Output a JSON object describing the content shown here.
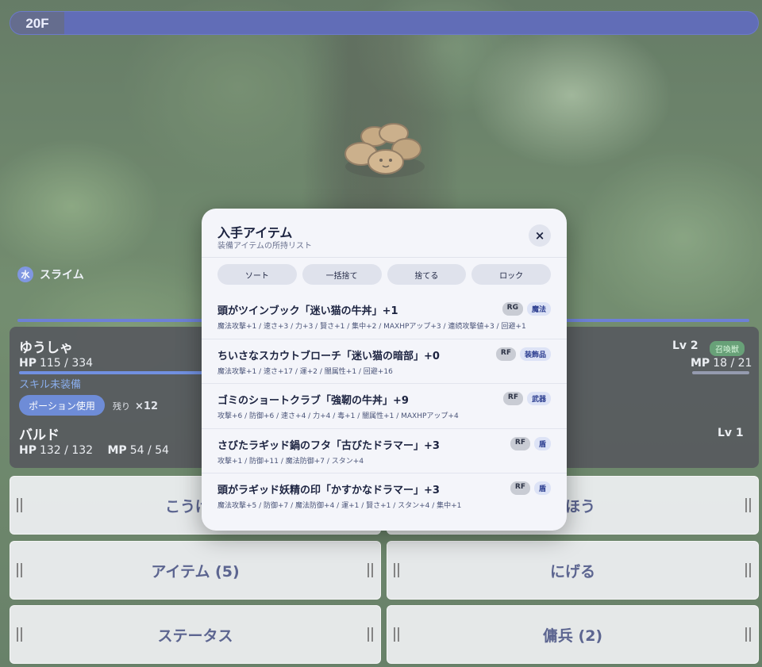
{
  "floor": {
    "label": "20F"
  },
  "enemy": {
    "element": "水",
    "name": "スライム"
  },
  "party": {
    "hero": {
      "name": "ゆうしゃ",
      "hp_label": "HP",
      "hp": "115 / 334",
      "lv": "Lv 2",
      "summon_badge": "召喚獣",
      "mp_label": "MP",
      "mp": "18 / 21",
      "skill": "スキル未装備",
      "potion_button": "ポーション使用",
      "potion_rest_label": "残り",
      "potion_rest_count": "×12"
    },
    "ally": {
      "name": "バルド",
      "hp_label": "HP",
      "hp": "132 / 132",
      "mp_label": "MP",
      "mp": "54 / 54",
      "lv": "Lv 1"
    }
  },
  "commands": [
    {
      "label": "こうげき"
    },
    {
      "label": "まほう"
    },
    {
      "label": "アイテム (5)"
    },
    {
      "label": "にげる"
    },
    {
      "label": "ステータス"
    },
    {
      "label": "傭兵 (2)"
    }
  ],
  "modal": {
    "title": "入手アイテム",
    "subtitle": "装備アイテムの所持リスト",
    "close": "×",
    "actions": [
      "ソート",
      "一括捨て",
      "捨てる",
      "ロック"
    ],
    "items": [
      {
        "name": "頭がツインブック「迷い猫の牛丼」+1",
        "rank": "RG",
        "category": "魔法",
        "stats": "魔法攻撃+1 / 速さ+3 / 力+3 / 賢さ+1 / 集中+2 / MAXHPアップ+3 / 連続攻撃値+3 / 回避+1"
      },
      {
        "name": "ちいさなスカウトブローチ「迷い猫の暗部」+0",
        "rank": "RF",
        "category": "装飾品",
        "stats": "魔法攻撃+1 / 速さ+17 / 運+2 / 闇属性+1 / 回避+16"
      },
      {
        "name": "ゴミのショートクラブ「強靭の牛丼」+9",
        "rank": "RF",
        "category": "武器",
        "stats": "攻撃+6 / 防御+6 / 速さ+4 / 力+4 / 毒+1 / 闇属性+1 / MAXHPアップ+4"
      },
      {
        "name": "さびたラギッド鍋のフタ「古びたドラマー」+3",
        "rank": "RF",
        "category": "盾",
        "stats": "攻撃+1 / 防御+11 / 魔法防御+7 / スタン+4"
      },
      {
        "name": "頭がラギッド妖精の印「かすかなドラマー」+3",
        "rank": "RF",
        "category": "盾",
        "stats": "魔法攻撃+5 / 防御+7 / 魔法防御+4 / 運+1 / 賢さ+1 / スタン+4 / 集中+1"
      }
    ]
  }
}
